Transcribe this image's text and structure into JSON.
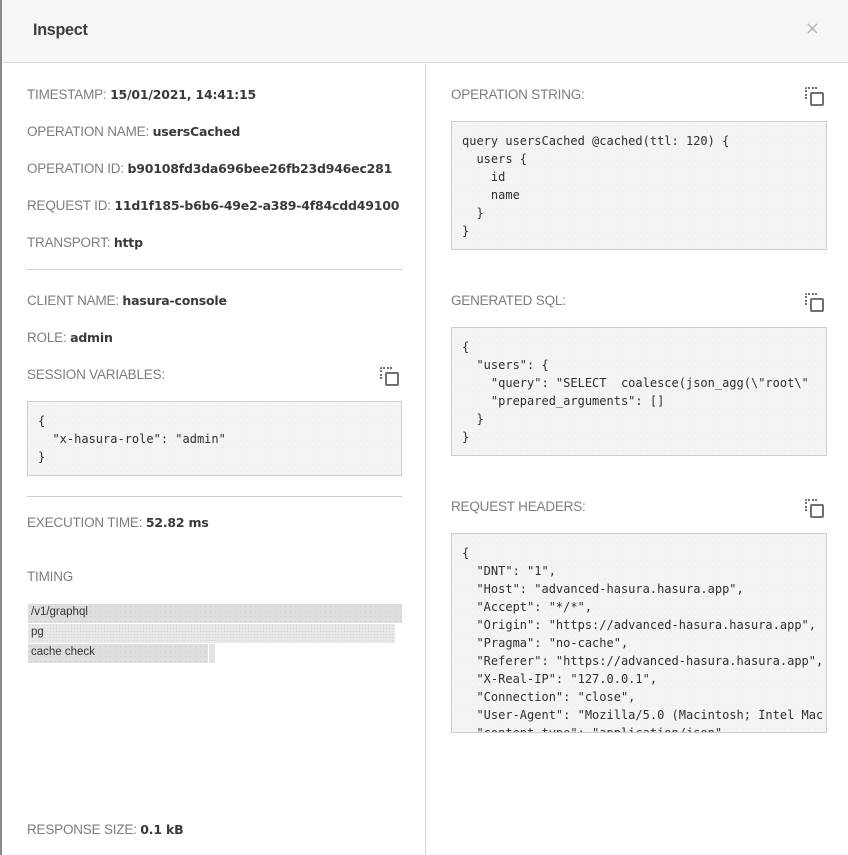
{
  "modal": {
    "title": "Inspect",
    "close_icon": "×"
  },
  "left": {
    "timestamp": {
      "label": "TIMESTAMP: ",
      "value": "15/01/2021, 14:41:15"
    },
    "operation_name": {
      "label": "OPERATION NAME: ",
      "value": "usersCached"
    },
    "operation_id": {
      "label": "OPERATION ID: ",
      "value": "b90108fd3da696bee26fb23d946ec281"
    },
    "request_id": {
      "label": "REQUEST ID: ",
      "value": "11d1f185-b6b6-49e2-a389-4f84cdd49100"
    },
    "transport": {
      "label": "TRANSPORT: ",
      "value": "http"
    },
    "client_name": {
      "label": "CLIENT NAME: ",
      "value": "hasura-console"
    },
    "role": {
      "label": "ROLE: ",
      "value": "admin"
    },
    "session_variables": {
      "label": "SESSION VARIABLES:",
      "code": "{\n  \"x-hasura-role\": \"admin\"\n}"
    },
    "execution_time": {
      "label": "EXECUTION TIME: ",
      "value": "52.82 ms"
    },
    "timing": {
      "label": "TIMING",
      "spans": [
        {
          "name": "/v1/graphql",
          "fraction": 1.0
        },
        {
          "name": "pg",
          "fraction": 0.98
        },
        {
          "name": "cache check",
          "fraction": 0.48,
          "extra_fraction": 0.015
        }
      ]
    },
    "response_size": {
      "label": "RESPONSE SIZE: ",
      "value": "0.1 kB"
    }
  },
  "right": {
    "operation_string": {
      "label": "OPERATION STRING:",
      "code": "query usersCached @cached(ttl: 120) {\n  users {\n    id\n    name\n  }\n}"
    },
    "generated_sql": {
      "label": "GENERATED SQL:",
      "code": "{\n  \"users\": {\n    \"query\": \"SELECT  coalesce(json_agg(\\\"root\\\"\n    \"prepared_arguments\": []\n  }\n}"
    },
    "request_headers": {
      "label": "REQUEST HEADERS:",
      "code": "{\n  \"DNT\": \"1\",\n  \"Host\": \"advanced-hasura.hasura.app\",\n  \"Accept\": \"*/*\",\n  \"Origin\": \"https://advanced-hasura.hasura.app\",\n  \"Pragma\": \"no-cache\",\n  \"Referer\": \"https://advanced-hasura.hasura.app\",\n  \"X-Real-IP\": \"127.0.0.1\",\n  \"Connection\": \"close\",\n  \"User-Agent\": \"Mozilla/5.0 (Macintosh; Intel Mac OS X)\",\n  \"content-type\": \"application/json\"\n}"
    }
  },
  "icons": {
    "copy": "copy-icon",
    "close": "close-icon"
  }
}
